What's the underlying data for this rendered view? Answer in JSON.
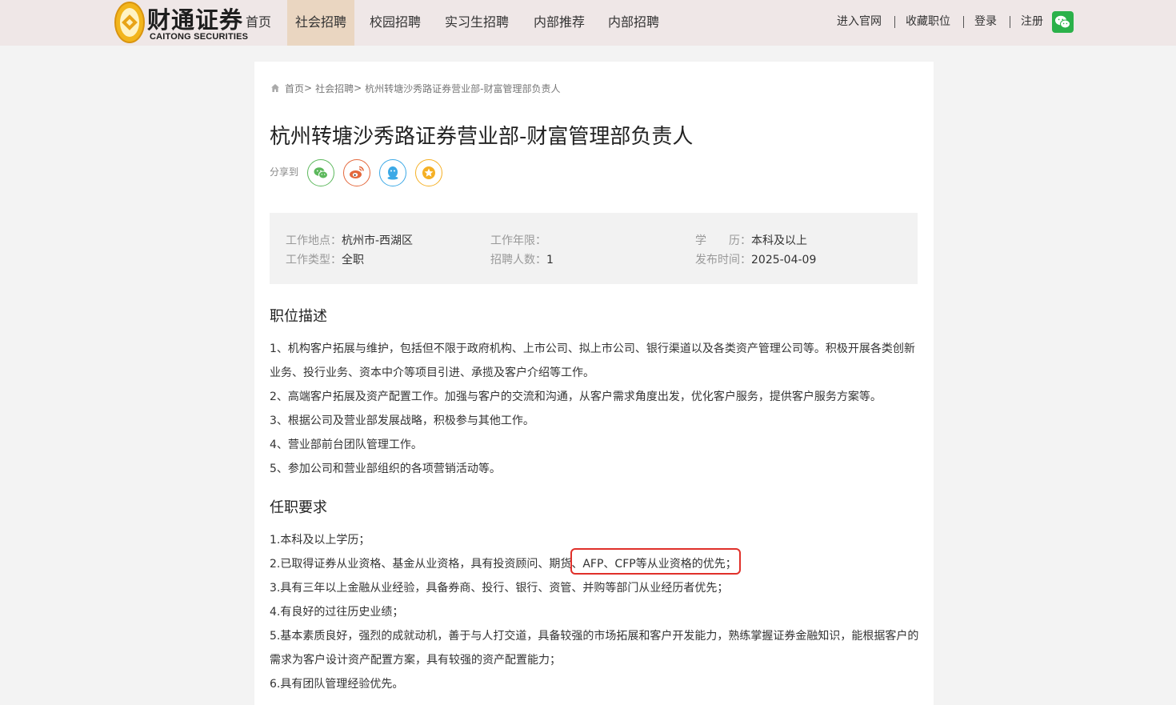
{
  "logo": {
    "cn": "财通证券",
    "en": "CAITONG SECURITIES"
  },
  "nav": [
    {
      "label": "首页",
      "active": false
    },
    {
      "label": "社会招聘",
      "active": true
    },
    {
      "label": "校园招聘",
      "active": false
    },
    {
      "label": "实习生招聘",
      "active": false
    },
    {
      "label": "内部推荐",
      "active": false
    },
    {
      "label": "内部招聘",
      "active": false
    }
  ],
  "top_links": {
    "official": "进入官网",
    "favorites": "收藏职位",
    "login": "登录",
    "register": "注册"
  },
  "breadcrumb": {
    "home": "首页",
    "sep": ">",
    "section": "社会招聘",
    "current": "杭州转塘沙秀路证券营业部-财富管理部负责人"
  },
  "job": {
    "title": "杭州转塘沙秀路证券营业部-财富管理部负责人",
    "share_label": "分享到",
    "info": {
      "location_label": "工作地点：",
      "location": "杭州市-西湖区",
      "years_label": "工作年限：",
      "years": "",
      "education_label": "学　　历：",
      "education": "本科及以上",
      "type_label": "工作类型：",
      "type": "全职",
      "headcount_label": "招聘人数：",
      "headcount": "1",
      "date_label": "发布时间：",
      "date": "2025-04-09"
    },
    "description_heading": "职位描述",
    "description": [
      "1、机构客户拓展与维护，包括但不限于政府机构、上市公司、拟上市公司、银行渠道以及各类资产管理公司等。积极开展各类创新",
      "业务、投行业务、资本中介等项目引进、承揽及客户介绍等工作。",
      "2、高端客户拓展及资产配置工作。加强与客户的交流和沟通，从客户需求角度出发，优化客户服务，提供客户服务方案等。",
      "3、根据公司及营业部发展战略，积极参与其他工作。",
      "4、营业部前台团队管理工作。",
      "5、参加公司和营业部组织的各项营销活动等。"
    ],
    "requirements_heading": "任职要求",
    "requirements": [
      "1.本科及以上学历；",
      "2.已取得证券从业资格、基金从业资格，具有投资顾问、期货、AFP、CFP等从业资格的优先；",
      "3.具有三年以上金融从业经验，具备券商、投行、银行、资管、并购等部门从业经历者优先；",
      "4.有良好的过往历史业绩；",
      "5.基本素质良好，强烈的成就动机，善于与人打交道，具备较强的市场拓展和客户开发能力，熟练掌握证券金融知识，能根据客户的",
      "需求为客户设计资产配置方案，具有较强的资产配置能力；",
      "6.具有团队管理经验优先。"
    ]
  },
  "colors": {
    "brand_gold": "#e8a317",
    "active_nav": "#ead6c1",
    "highlight": "#e0302a"
  },
  "icons": [
    "home-icon",
    "wechat-icon",
    "weibo-icon",
    "qq-icon",
    "favorite-star-icon"
  ]
}
